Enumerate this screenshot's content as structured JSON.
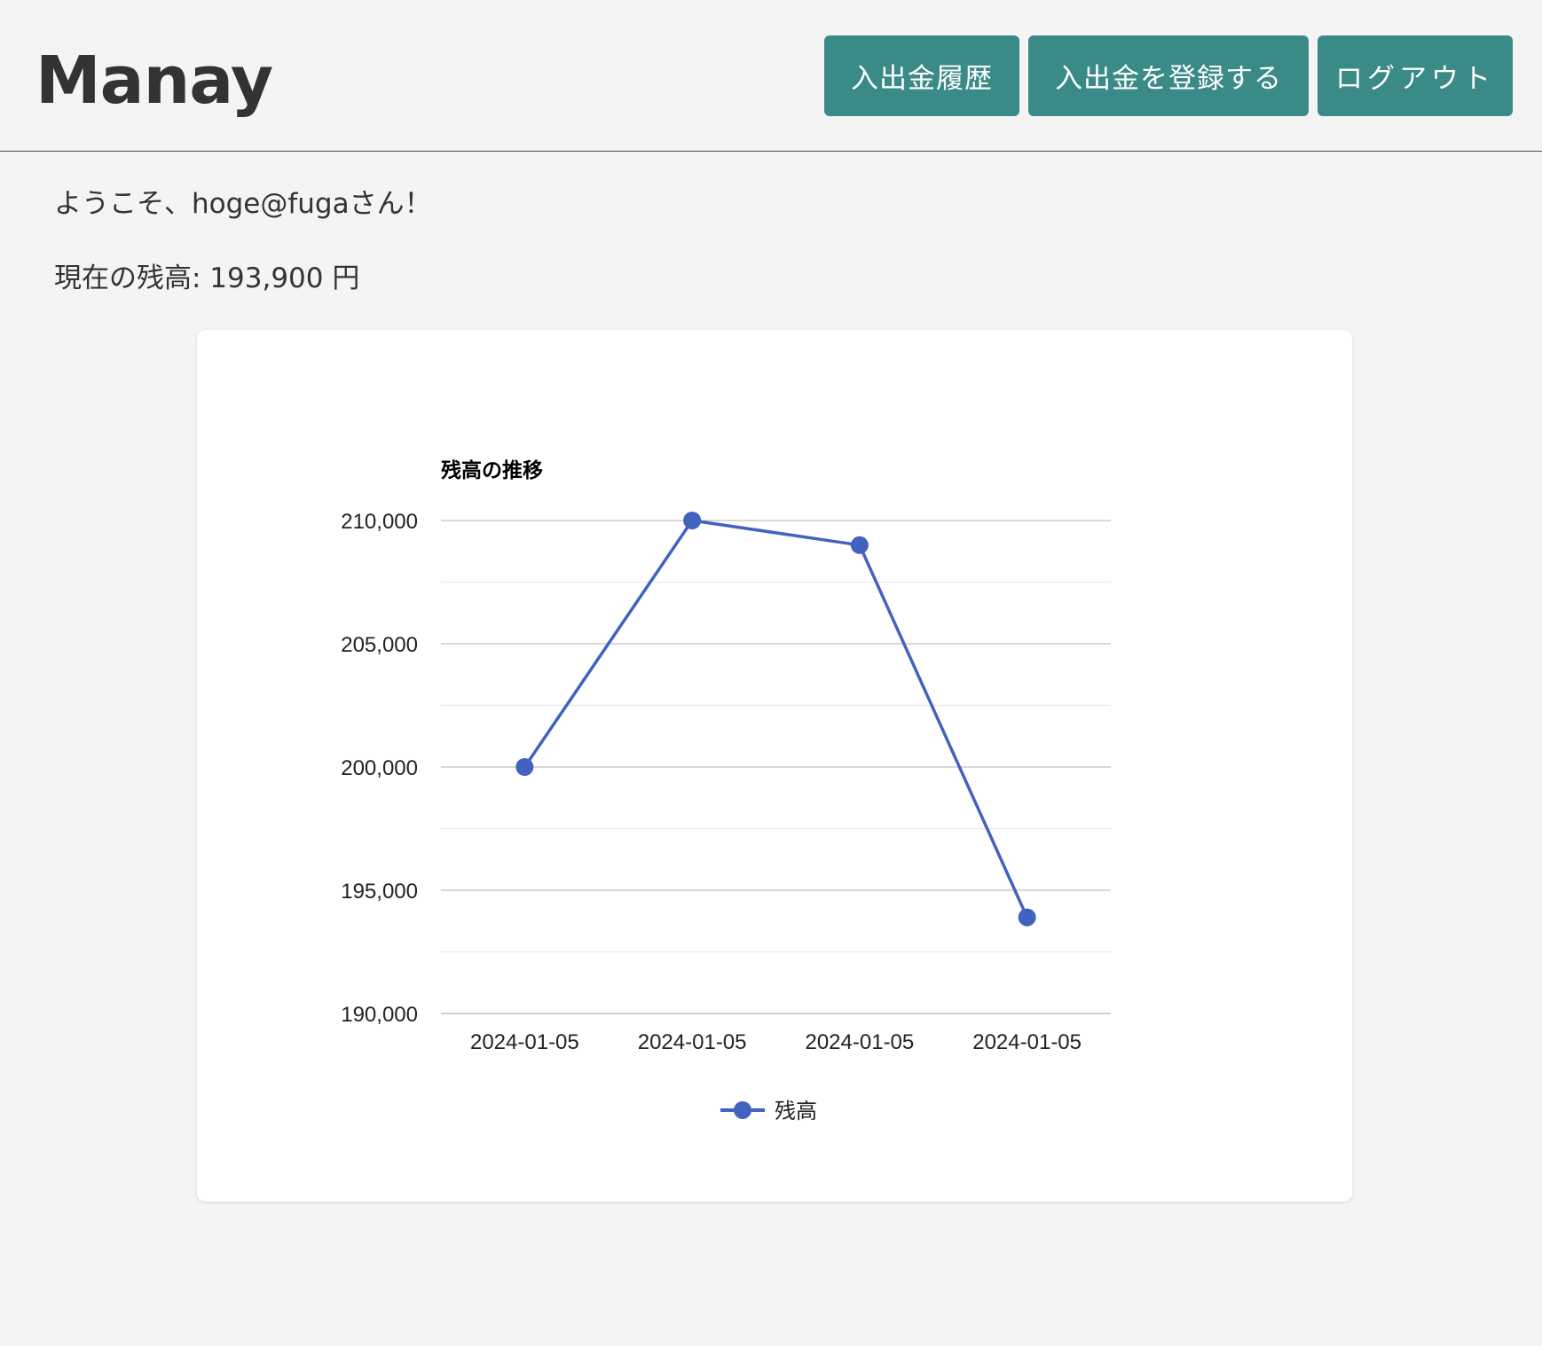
{
  "header": {
    "logo": "Manay",
    "nav": {
      "history_label": "入出金履歴",
      "register_label": "入出金を登録する",
      "logout_label": "ログアウト"
    }
  },
  "main": {
    "welcome": "ようこそ、hoge@fugaさん！",
    "balance": "現在の残高: 193,900 円"
  },
  "colors": {
    "button": "#3a8a87",
    "series": "#4262c0"
  },
  "chart_data": {
    "type": "line",
    "title": "残高の推移",
    "categories": [
      "2024-01-05",
      "2024-01-05",
      "2024-01-05",
      "2024-01-05"
    ],
    "series": [
      {
        "name": "残高",
        "values": [
          200000,
          210000,
          209000,
          193900
        ]
      }
    ],
    "ylim": [
      190000,
      210000
    ],
    "yticks": [
      190000,
      195000,
      200000,
      205000,
      210000
    ],
    "ytick_labels": [
      "190,000",
      "195,000",
      "200,000",
      "205,000",
      "210,000"
    ],
    "grid": true,
    "legend": "bottom"
  }
}
